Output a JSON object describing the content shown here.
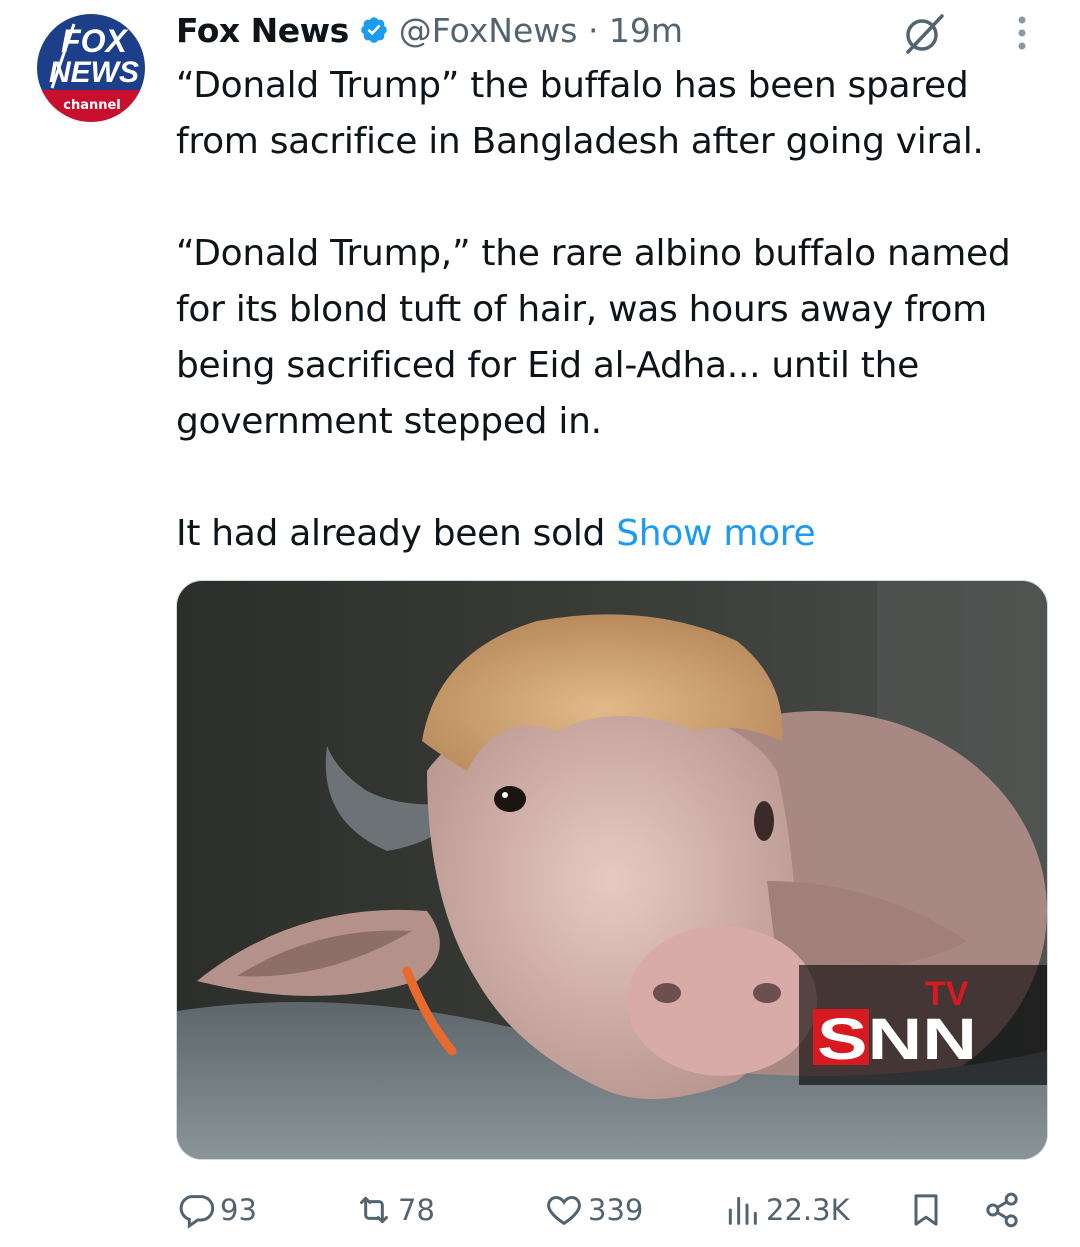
{
  "author": {
    "name": "Fox News",
    "handle_time": "@FoxNews · 19m",
    "avatar_logo": {
      "line1": "FOX",
      "line2": "NEWS",
      "line3": "channel"
    }
  },
  "tweet": {
    "para1": "“Donald Trump” the buffalo has been spared from sacrifice in Bangladesh after going viral.",
    "para2": "“Donald Trump,” the rare albino buffalo named for its blond tuft of hair, was hours away from being sacrificed for Eid al-Adha... until the government stepped in.",
    "para3": "It had already been sold",
    "show_more": "Show more"
  },
  "media": {
    "watermark_main": "SNN",
    "watermark_tv": "TV"
  },
  "actions": {
    "replies": "93",
    "reposts": "78",
    "likes": "339",
    "views": "22.3K"
  },
  "colors": {
    "accent": "#1d9bf0",
    "muted": "#536471",
    "fox_red": "#c8102e",
    "fox_blue": "#1d3f8a"
  },
  "icons": [
    "verified-badge-icon",
    "grok-icon",
    "more-icon",
    "reply-icon",
    "repost-icon",
    "like-icon",
    "views-icon",
    "bookmark-icon",
    "share-icon"
  ]
}
